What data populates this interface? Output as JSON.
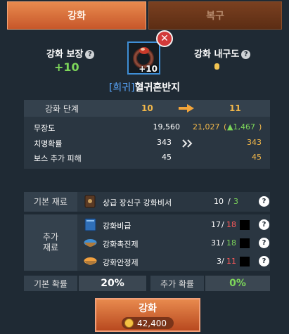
{
  "tabs": {
    "enhance": "강화",
    "restore": "복구"
  },
  "header": {
    "guarantee_label": "강화 보장",
    "guarantee_value": "+10",
    "durability_label": "강화 내구도",
    "help_glyph": "?",
    "close_glyph": "✕"
  },
  "item": {
    "level": "+10",
    "grade": "[희귀]",
    "name": "혈귀혼반지",
    "frame_color": "#3f8fd6"
  },
  "stage": {
    "label": "강화 단계",
    "from": "10",
    "to": "11"
  },
  "stats": [
    {
      "name": "무장도",
      "current": "19,560",
      "next": "21,027",
      "delta": "▲1,467"
    },
    {
      "name": "치명확률",
      "current": "343",
      "next": "343"
    },
    {
      "name": "보스 추가 피해",
      "current": "45",
      "next": "45"
    }
  ],
  "materials": {
    "base_label": "기본 재료",
    "extra_label_1": "추가",
    "extra_label_2": "재료",
    "base": {
      "name": "상급 장신구 강화비서",
      "have": "10",
      "need": "3",
      "icon": "scroll-icon"
    },
    "extra": [
      {
        "name": "강화비급",
        "have": "17",
        "need": "18",
        "icon": "book-icon"
      },
      {
        "name": "강화촉진제",
        "have": "31",
        "need": "18",
        "icon": "blue-bowl-icon"
      },
      {
        "name": "강화안정제",
        "have": "3",
        "need": "11",
        "icon": "orange-bowl-icon"
      }
    ]
  },
  "probability": {
    "base_label": "기본 확률",
    "base_value": "20%",
    "extra_label": "추가 확률",
    "extra_value": "0%"
  },
  "action": {
    "label": "강화",
    "cost": "42,400"
  },
  "colors": {
    "accent": "#e07a44",
    "green": "#7dd65a",
    "red": "#ff5a5a",
    "gold": "#f3b84a"
  }
}
